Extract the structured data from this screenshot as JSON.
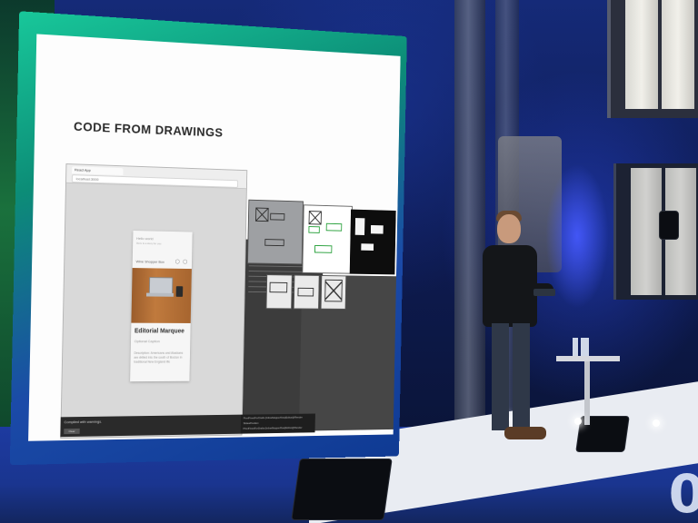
{
  "slide": {
    "title": "CODE FROM DRAWINGS",
    "browser_tab": "React App",
    "browser_url": "localhost:3000",
    "card": {
      "greeting": "Hello world",
      "subtitle": "Here is a story for you",
      "row_label": "Wine Shopper Box",
      "title": "Editorial Marquee",
      "caption": "Optional Caption",
      "description": "Description: Americans and Alaskans are drilled into the south of Boston in traditional New England life"
    },
    "console_text": "Compiled with warnings.",
    "console_button": "Clear",
    "log_lines": [
      "PixelFixedForDrafts [InlineMapperRow]Editor@Render",
      "  SlidesPosition",
      "  PixelFixedForDrafts [InlineMapperRow]Editor@Render"
    ]
  },
  "led_text": "0"
}
